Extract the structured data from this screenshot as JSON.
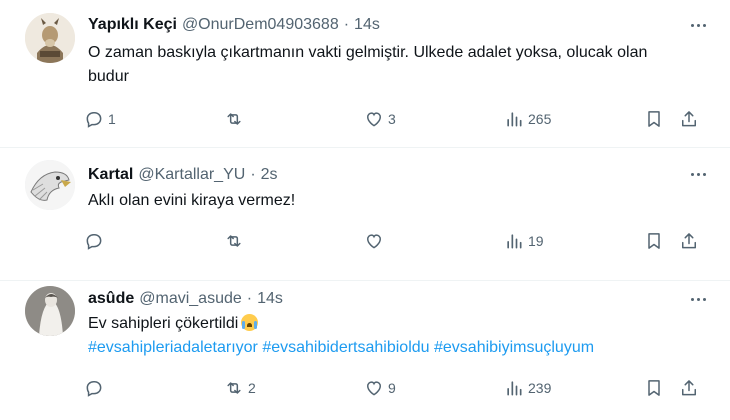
{
  "tweets": [
    {
      "name": "Yapıklı Keçi",
      "handle": "@OnurDem04903688",
      "separator": "·",
      "time": "14s",
      "text": "O zaman baskıyla çıkartmanın vakti gelmiştir. Ulkede adalet yoksa, olucak olan budur",
      "replies": "1",
      "retweets": "",
      "likes": "3",
      "views": "265"
    },
    {
      "name": "Kartal",
      "handle": "@Kartallar_YU",
      "separator": "·",
      "time": "2s",
      "text": "Aklı olan evini kiraya vermez!",
      "replies": "",
      "retweets": "",
      "likes": "",
      "views": "19"
    },
    {
      "name": "asûde",
      "handle": "@mavi_asude",
      "separator": "·",
      "time": "14s",
      "text": "Ev sahipleri çökertildi",
      "hashtags": "#evsahipleriadaletarıyor #evsahibidertsahibioldu #evsahibiyimsuçluyum",
      "replies": "",
      "retweets": "2",
      "likes": "9",
      "views": "239"
    }
  ],
  "icons": {
    "reply": "reply-icon",
    "retweet": "retweet-icon",
    "like": "heart-icon",
    "views": "views-icon",
    "bookmark": "bookmark-icon",
    "share": "share-icon",
    "more": "more-icon",
    "emoji": "crying-face-emoji"
  },
  "colors": {
    "text": "#0f1419",
    "secondary": "#536471",
    "link": "#1d9bf0",
    "divider": "#eff3f4"
  }
}
